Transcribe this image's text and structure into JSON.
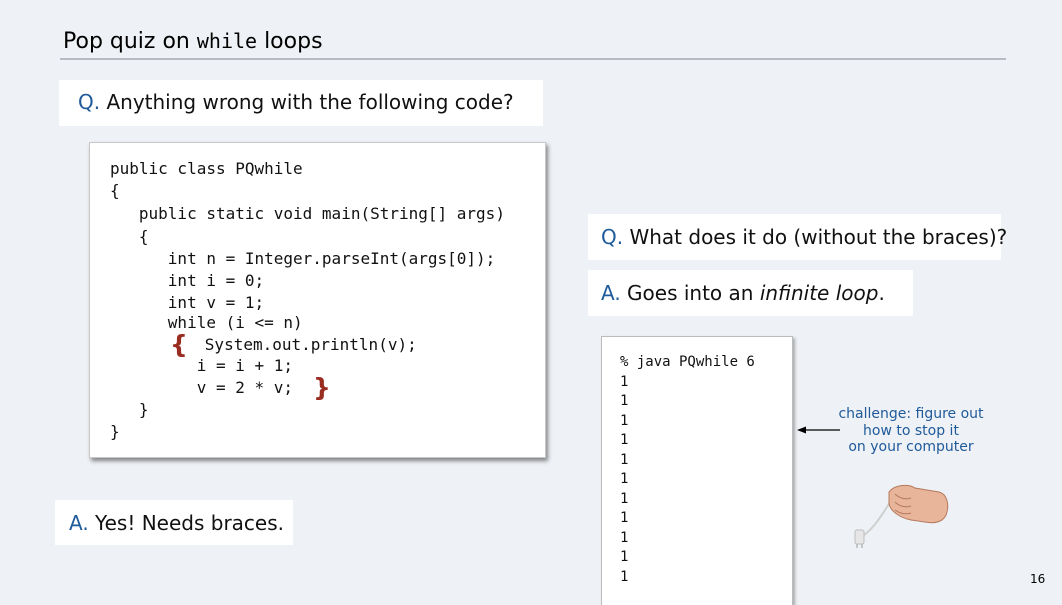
{
  "slide": {
    "title_prefix": "Pop quiz on ",
    "title_code": "while",
    "title_suffix": " loops",
    "page_number": "16"
  },
  "question1": {
    "tag": "Q.",
    "text": " Anything wrong with the following code?"
  },
  "answer1": {
    "tag": "A.",
    "text": " Yes! Needs braces."
  },
  "question2": {
    "tag": "Q.",
    "text": " What does it do (without the braces)?"
  },
  "answer2": {
    "tag": "A.",
    "text": " Goes into an ",
    "emphasis": "infinite loop",
    "end": "."
  },
  "code": {
    "lines": [
      "public class PQwhile",
      "{",
      "   public static void main(String[] args)",
      "   {",
      "      int n = Integer.parseInt(args[0]);",
      "      int i = 0;",
      "      int v = 1;",
      "      while (i <= n)",
      "      System.out.println(v);",
      "         i = i + 1;",
      "         v = 2 * v;",
      "   }",
      "}"
    ],
    "open_brace": "{",
    "close_brace": "}",
    "accent_color": "#9a2d22"
  },
  "output": {
    "command": "% java PQwhile 6",
    "lines": [
      "1",
      "1",
      "1",
      "1",
      "1",
      "1",
      "1",
      "1",
      "1",
      "1",
      "1"
    ]
  },
  "challenge": {
    "line1": "challenge: figure out",
    "line2": "how to stop it",
    "line3": "on your computer"
  },
  "colors": {
    "accent_blue": "#1f5a9a",
    "brace_red": "#9a2d22",
    "background": "#eef1f5"
  }
}
